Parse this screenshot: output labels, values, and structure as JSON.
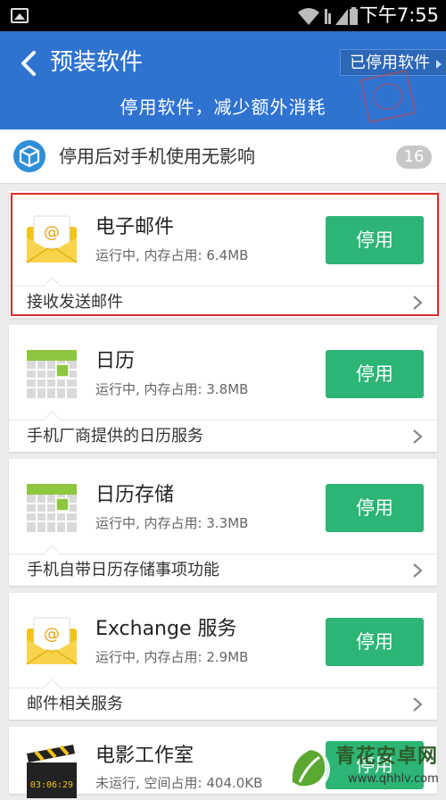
{
  "status_bar": {
    "time": "下午7:55"
  },
  "header": {
    "title": "预装软件",
    "disabled_link": "已停用软件",
    "subtitle": "停用软件，减少额外消耗"
  },
  "info": {
    "text": "停用后对手机使用无影响",
    "count": "16"
  },
  "apps": [
    {
      "name": "电子邮件",
      "status": "运行中, 内存占用: 6.4MB",
      "button": "停用",
      "description": "接收发送邮件",
      "icon": "mail-icon"
    },
    {
      "name": "日历",
      "status": "运行中, 内存占用: 3.8MB",
      "button": "停用",
      "description": "手机厂商提供的日历服务",
      "icon": "calendar-icon"
    },
    {
      "name": "日历存储",
      "status": "运行中, 内存占用: 3.3MB",
      "button": "停用",
      "description": "手机自带日历存储事项功能",
      "icon": "calendar-icon"
    },
    {
      "name": "Exchange 服务",
      "status": "运行中, 内存占用: 2.9MB",
      "button": "停用",
      "description": "邮件相关服务",
      "icon": "mail-icon"
    },
    {
      "name": "电影工作室",
      "status": "未运行, 空间占用: 404.0KB",
      "button": "停用",
      "icon": "clapperboard-icon",
      "clock_text": "03:06:29"
    }
  ],
  "watermark": {
    "title": "青花安卓网",
    "url": "www.qhhlv.com"
  },
  "colors": {
    "header": "#2f73d1",
    "button": "#2db575",
    "highlight": "#e12a2a"
  }
}
